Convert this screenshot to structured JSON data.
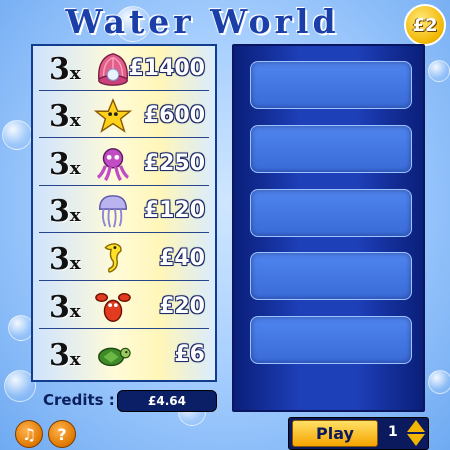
{
  "header": {
    "title": "Water World",
    "price_badge": "£2"
  },
  "paytable": {
    "rows": [
      {
        "count": "3",
        "multiplier": "x",
        "icon": "clam-shell-pearl-icon",
        "prize": "£1400"
      },
      {
        "count": "3",
        "multiplier": "x",
        "icon": "starfish-icon",
        "prize": "£600"
      },
      {
        "count": "3",
        "multiplier": "x",
        "icon": "octopus-icon",
        "prize": "£250"
      },
      {
        "count": "3",
        "multiplier": "x",
        "icon": "jellyfish-icon",
        "prize": "£120"
      },
      {
        "count": "3",
        "multiplier": "x",
        "icon": "seahorse-icon",
        "prize": "£40"
      },
      {
        "count": "3",
        "multiplier": "x",
        "icon": "lobster-icon",
        "prize": "£20"
      },
      {
        "count": "3",
        "multiplier": "x",
        "icon": "turtle-icon",
        "prize": "£6"
      }
    ]
  },
  "board": {
    "slot_count": 5
  },
  "footer": {
    "credits_label": "Credits :",
    "credits_value": "£4.64",
    "play_label": "Play",
    "stake_value": "1",
    "sound_icon": "music-note-icon",
    "help_icon": "question-mark-icon"
  },
  "colors": {
    "background": "#a9d0ff",
    "board": "#1d3fb8",
    "slot": "#4f84ee",
    "accent": "#f5a400",
    "title": "#1a3fa8"
  }
}
